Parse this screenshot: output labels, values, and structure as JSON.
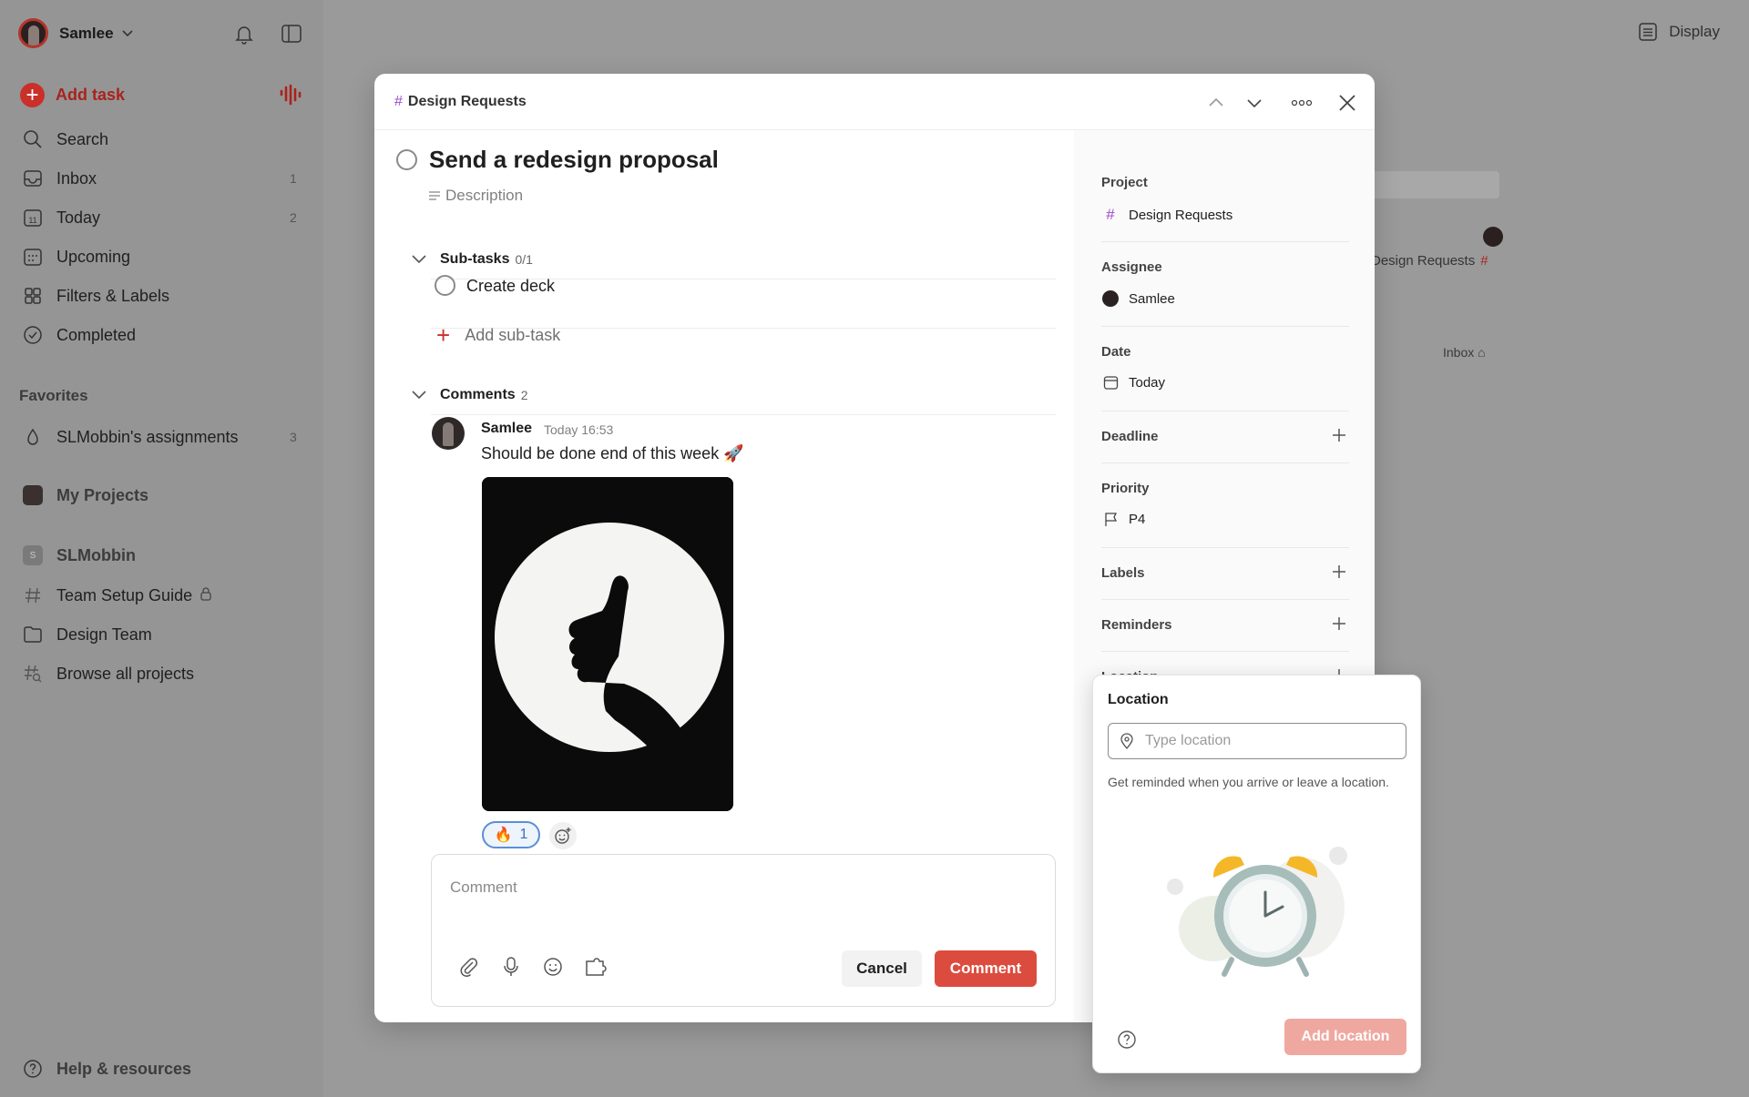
{
  "sidebar": {
    "user_name": "Samlee",
    "add_task": "Add task",
    "nav": [
      {
        "label": "Search",
        "count": ""
      },
      {
        "label": "Inbox",
        "count": "1"
      },
      {
        "label": "Today",
        "count": "2"
      },
      {
        "label": "Upcoming",
        "count": ""
      },
      {
        "label": "Filters & Labels",
        "count": ""
      },
      {
        "label": "Completed",
        "count": ""
      }
    ],
    "today_icon_day": "11",
    "favorites_heading": "Favorites",
    "favorites": [
      {
        "label": "SLMobbin's assignments",
        "count": "3"
      }
    ],
    "my_projects": "My Projects",
    "workspace": "SLMobbin",
    "workspace_badge": "S",
    "workspace_items": [
      {
        "label": "Team Setup Guide"
      },
      {
        "label": "Design Team"
      },
      {
        "label": "Browse all projects"
      }
    ],
    "help": "Help & resources"
  },
  "background": {
    "display": "Display",
    "project_tag": "Design Requests",
    "project_hash": "#",
    "inbox": "Inbox"
  },
  "modal": {
    "breadcrumb": "Design Requests",
    "breadcrumb_hash": "#",
    "task_title": "Send a redesign proposal",
    "description_placeholder": "Description",
    "subtasks_label": "Sub-tasks",
    "subtasks_count": "0/1",
    "subtasks": [
      {
        "label": "Create deck"
      }
    ],
    "add_subtask": "Add sub-task",
    "comments_label": "Comments",
    "comments_count": "2",
    "comment": {
      "author": "Samlee",
      "time": "Today 16:53",
      "text": "Should be done end of this week 🚀",
      "reaction_emoji": "🔥",
      "reaction_count": "1"
    },
    "comment_placeholder": "Comment",
    "cancel": "Cancel",
    "submit": "Comment"
  },
  "details": {
    "project_label": "Project",
    "project_value": "Design Requests",
    "assignee_label": "Assignee",
    "assignee_value": "Samlee",
    "date_label": "Date",
    "date_value": "Today",
    "deadline_label": "Deadline",
    "priority_label": "Priority",
    "priority_value": "P4",
    "labels_label": "Labels",
    "reminders_label": "Reminders",
    "location_label": "Location"
  },
  "location_popover": {
    "title": "Location",
    "placeholder": "Type location",
    "help_text": "Get reminded when you arrive or leave a location.",
    "add_button": "Add location"
  },
  "colors": {
    "accent_red": "#dc4c3e",
    "project_hash": "#9c4bc7",
    "add_location_disabled": "#efa8a0"
  }
}
